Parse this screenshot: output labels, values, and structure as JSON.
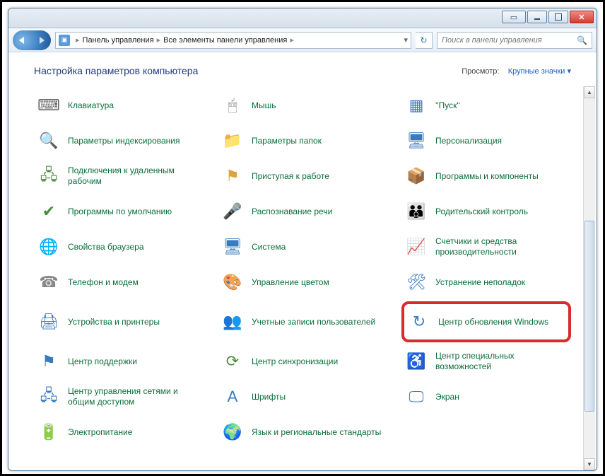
{
  "window": {
    "tool_btn": "▭",
    "close_btn": "✕"
  },
  "breadcrumb": {
    "root_icon": "▣",
    "path1": "Панель управления",
    "path2": "Все элементы панели управления",
    "dropdown": "▾",
    "refresh": "↻"
  },
  "search": {
    "placeholder": "Поиск в панели управления",
    "icon": "🔍"
  },
  "header": {
    "title": "Настройка параметров компьютера",
    "view_label": "Просмотр:",
    "view_value": "Крупные значки"
  },
  "items": [
    {
      "label": "Клавиатура",
      "icon": "⌨",
      "c1": "#666"
    },
    {
      "label": "Мышь",
      "icon": "🖱",
      "c1": "#888"
    },
    {
      "label": "''Пуск''",
      "icon": "▦",
      "c1": "#3a7bbf"
    },
    {
      "label": "Параметры индексирования",
      "icon": "🔍",
      "c1": "#3a7bbf"
    },
    {
      "label": "Параметры папок",
      "icon": "📁",
      "c1": "#e6b94d"
    },
    {
      "label": "Персонализация",
      "icon": "🖥",
      "c1": "#3a7bbf"
    },
    {
      "label": "Подключения к удаленным рабочим",
      "icon": "🖧",
      "c1": "#4a8c3d"
    },
    {
      "label": "Приступая к работе",
      "icon": "⚑",
      "c1": "#d9a441"
    },
    {
      "label": "Программы и компоненты",
      "icon": "📦",
      "c1": "#3a7bbf"
    },
    {
      "label": "Программы по умолчанию",
      "icon": "✔",
      "c1": "#4a8c3d"
    },
    {
      "label": "Распознавание речи",
      "icon": "🎤",
      "c1": "#888"
    },
    {
      "label": "Родительский контроль",
      "icon": "👪",
      "c1": "#d9a441"
    },
    {
      "label": "Свойства браузера",
      "icon": "🌐",
      "c1": "#3a7bbf"
    },
    {
      "label": "Система",
      "icon": "🖥",
      "c1": "#3a7bbf"
    },
    {
      "label": "Счетчики и средства производительности",
      "icon": "📈",
      "c1": "#4a8c3d"
    },
    {
      "label": "Телефон и модем",
      "icon": "☎",
      "c1": "#888"
    },
    {
      "label": "Управление цветом",
      "icon": "🎨",
      "c1": "#d9544d"
    },
    {
      "label": "Устранение неполадок",
      "icon": "🛠",
      "c1": "#3a7bbf"
    },
    {
      "label": "Устройства и принтеры",
      "icon": "🖨",
      "c1": "#3a7bbf"
    },
    {
      "label": "Учетные записи пользователей",
      "icon": "👥",
      "c1": "#4a8c3d"
    },
    {
      "label": "Центр обновления Windows",
      "icon": "↻",
      "c1": "#3a7bbf",
      "highlight": true
    },
    {
      "label": "Центр поддержки",
      "icon": "⚑",
      "c1": "#3a7bbf"
    },
    {
      "label": "Центр синхронизации",
      "icon": "⟳",
      "c1": "#4a8c3d"
    },
    {
      "label": "Центр специальных возможностей",
      "icon": "♿",
      "c1": "#3a7bbf"
    },
    {
      "label": "Центр управления сетями и общим доступом",
      "icon": "🖧",
      "c1": "#3a7bbf"
    },
    {
      "label": "Шрифты",
      "icon": "A",
      "c1": "#3a7bbf"
    },
    {
      "label": "Экран",
      "icon": "🖵",
      "c1": "#3a7bbf"
    },
    {
      "label": "Электропитание",
      "icon": "🔋",
      "c1": "#4a8c3d"
    },
    {
      "label": "Язык и региональные стандарты",
      "icon": "🌍",
      "c1": "#3a7bbf"
    }
  ],
  "scrollbar": {
    "up": "▲",
    "down": "▼"
  }
}
